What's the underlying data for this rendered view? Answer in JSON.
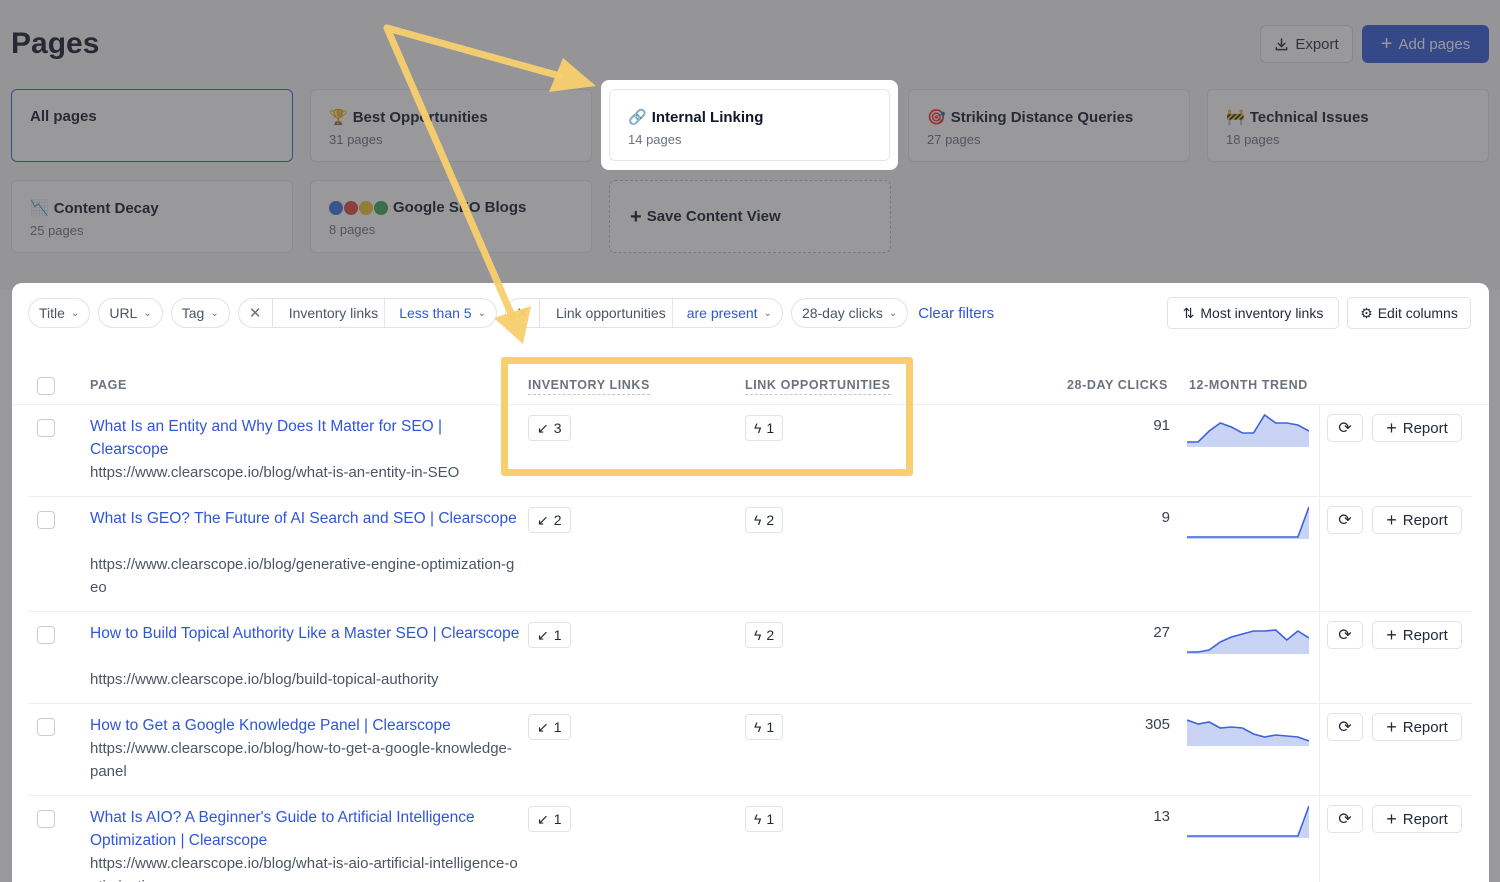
{
  "header": {
    "title": "Pages",
    "export_label": "Export",
    "add_label": "Add pages"
  },
  "views": [
    {
      "title": "All pages",
      "sub": ""
    },
    {
      "title": "Best Opportunities",
      "sub": "31 pages",
      "icon": "trophy-icon"
    },
    {
      "title": "Internal Linking",
      "sub": "14 pages",
      "icon": "link-icon"
    },
    {
      "title": "Striking Distance Queries",
      "sub": "27 pages",
      "icon": "target-icon"
    },
    {
      "title": "Technical Issues",
      "sub": "18 pages",
      "icon": "construction-icon"
    },
    {
      "title": "Content Decay",
      "sub": "25 pages",
      "icon": "chart-down-icon"
    },
    {
      "title": "Google SEO Blogs",
      "sub": "8 pages",
      "icon": "google-dots-icon"
    },
    {
      "title": "Save Content View"
    }
  ],
  "filters": {
    "title": "Title",
    "url": "URL",
    "tag": "Tag",
    "inv_name": "Inventory links",
    "inv_value": "Less than 5",
    "opp_name": "Link opportunities",
    "opp_value": "are present",
    "clicks": "28-day clicks",
    "clear": "Clear filters",
    "sort": "Most inventory links",
    "edit": "Edit columns"
  },
  "columns": {
    "page": "PAGE",
    "inventory": "INVENTORY LINKS",
    "opportunities": "LINK OPPORTUNITIES",
    "clicks": "28-DAY CLICKS",
    "trend": "12-MONTH TREND"
  },
  "report_label": "Report",
  "rows": [
    {
      "title": "What Is an Entity and Why Does It Matter for SEO | Clearscope",
      "url": "https://www.clearscope.io/blog/what-is-an-entity-in-SEO",
      "inventory": "3",
      "opportunities": "1",
      "clicks": "91",
      "trend": [
        3,
        3,
        14,
        22,
        18,
        12,
        12,
        30,
        22,
        22,
        20,
        14
      ]
    },
    {
      "title": "What Is GEO? The Future of AI Search and SEO | Clearscope",
      "url": "https://www.clearscope.io/blog/generative-engine-optimization-geo",
      "inventory": "2",
      "opportunities": "2",
      "clicks": "9",
      "trend": [
        0,
        0,
        0,
        0,
        0,
        0,
        0,
        0,
        0,
        0,
        0,
        30
      ]
    },
    {
      "title": "How to Build Topical Authority Like a Master SEO | Clearscope",
      "url": "https://www.clearscope.io/blog/build-topical-authority",
      "inventory": "1",
      "opportunities": "2",
      "clicks": "27",
      "trend": [
        0,
        0,
        2,
        10,
        15,
        18,
        21,
        21,
        22,
        12,
        21,
        14
      ]
    },
    {
      "title": "How to Get a Google Knowledge Panel | Clearscope",
      "url": "https://www.clearscope.io/blog/how-to-get-a-google-knowledge-panel",
      "inventory": "1",
      "opportunities": "1",
      "clicks": "305",
      "trend": [
        24,
        20,
        22,
        16,
        17,
        16,
        10,
        7,
        9,
        8,
        7,
        3
      ]
    },
    {
      "title": "What Is AIO? A Beginner's Guide to Artificial Intelligence Optimization | Clearscope",
      "url": "https://www.clearscope.io/blog/what-is-aio-artificial-intelligence-optimization",
      "inventory": "1",
      "opportunities": "1",
      "clicks": "13",
      "trend": [
        0,
        0,
        0,
        0,
        0,
        0,
        0,
        0,
        0,
        0,
        0,
        30
      ]
    }
  ],
  "colors": {
    "accent": "#2f56d8",
    "highlight": "#f8cf6e",
    "trend_line": "#3d63dc",
    "trend_fill": "#c9d4f5"
  }
}
